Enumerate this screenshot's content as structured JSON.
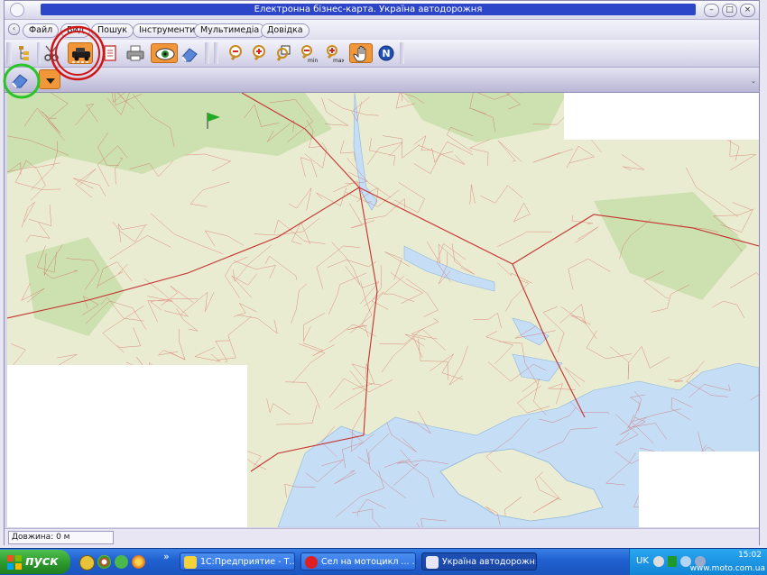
{
  "window": {
    "title": "Електронна бізнес-карта. Україна автодорожня",
    "buttons": [
      "minimize",
      "maximize",
      "close"
    ],
    "minimize_glyph": "–",
    "maximize_glyph": "□",
    "close_glyph": "×"
  },
  "menu": {
    "items": [
      {
        "label": "Файл"
      },
      {
        "label": "Вид"
      },
      {
        "label": "Пошук"
      },
      {
        "label": "Інструменти"
      },
      {
        "label": "Мультимедіа"
      },
      {
        "label": "Довідка"
      }
    ]
  },
  "toolbar": {
    "tools": [
      {
        "icon": "tree-layers-icon",
        "active": false
      },
      {
        "icon": "scissors-icon",
        "active": false
      },
      {
        "icon": "route-car-icon",
        "active": true
      },
      {
        "icon": "document-icon",
        "active": false
      },
      {
        "icon": "printer-icon",
        "active": false
      },
      {
        "icon": "eye-icon",
        "active": true
      },
      {
        "icon": "eraser-icon",
        "active": false
      },
      {
        "icon": "zoom-out-icon",
        "active": false
      },
      {
        "icon": "zoom-in-icon",
        "active": false
      },
      {
        "icon": "zoom-window-icon",
        "active": false
      },
      {
        "icon": "zoom-min-icon",
        "label": "min",
        "active": false
      },
      {
        "icon": "zoom-max-icon",
        "label": "max",
        "active": false
      },
      {
        "icon": "hand-pan-icon",
        "active": true
      },
      {
        "icon": "north-icon",
        "label": "N",
        "active": false
      }
    ]
  },
  "toolbar2": {
    "tools": [
      {
        "icon": "eraser-icon",
        "active": false
      },
      {
        "icon": "dropdown-arrow-icon",
        "active": true
      }
    ]
  },
  "map": {
    "land_color": "#e9ecd1",
    "water_color": "#c6def5",
    "road_color": "#d23b3b",
    "blank_color": "#ffffff"
  },
  "status": {
    "length_label": "Довжина: 0 м"
  },
  "taskbar": {
    "start_label": "пуск",
    "chevron": "»",
    "tasks": [
      {
        "label": "1С:Предприятие - Т...",
        "active": false
      },
      {
        "label": "Сел на мотоцикл ... ...",
        "active": false
      },
      {
        "label": "Україна автодорожня",
        "active": true
      }
    ],
    "language": "UK",
    "clock": "15:02",
    "watermark": "www.moto.com.ua"
  },
  "annotations": {
    "red_circle_color": "#d01515",
    "green_circle_color": "#28c428"
  }
}
